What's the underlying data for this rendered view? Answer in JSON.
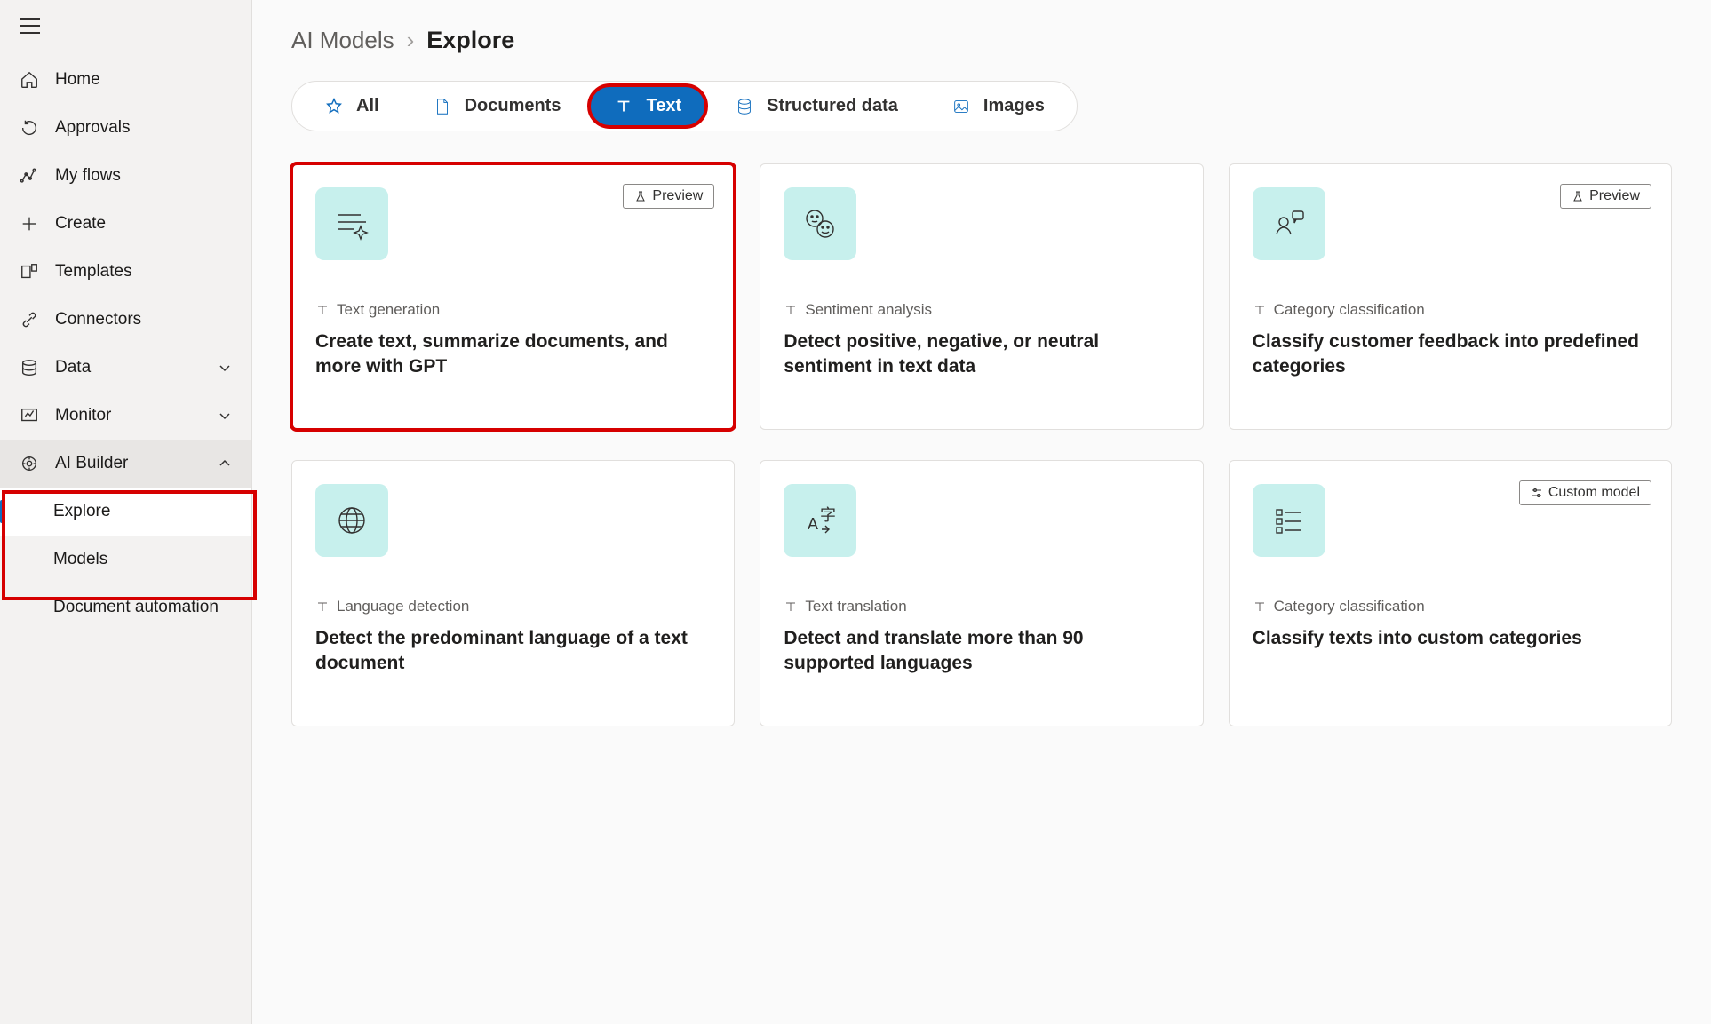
{
  "sidebar": {
    "items": [
      {
        "id": "home",
        "label": "Home"
      },
      {
        "id": "approvals",
        "label": "Approvals"
      },
      {
        "id": "myflows",
        "label": "My flows"
      },
      {
        "id": "create",
        "label": "Create"
      },
      {
        "id": "templates",
        "label": "Templates"
      },
      {
        "id": "connectors",
        "label": "Connectors"
      },
      {
        "id": "data",
        "label": "Data",
        "expandable": true
      },
      {
        "id": "monitor",
        "label": "Monitor",
        "expandable": true
      },
      {
        "id": "aibuilder",
        "label": "AI Builder",
        "expandable": true,
        "expanded": true
      }
    ],
    "aibuilder_children": [
      {
        "id": "explore",
        "label": "Explore",
        "active": true
      },
      {
        "id": "models",
        "label": "Models"
      },
      {
        "id": "docauto",
        "label": "Document automation"
      }
    ]
  },
  "breadcrumb": {
    "parent": "AI Models",
    "current": "Explore"
  },
  "filters": [
    {
      "id": "all",
      "label": "All"
    },
    {
      "id": "documents",
      "label": "Documents"
    },
    {
      "id": "text",
      "label": "Text",
      "active": true
    },
    {
      "id": "structured",
      "label": "Structured data"
    },
    {
      "id": "images",
      "label": "Images"
    }
  ],
  "cards_row1": [
    {
      "badge": "Preview",
      "category": "Text generation",
      "title": "Create text, summarize documents, and more with GPT",
      "icon": "sparkle-lines"
    },
    {
      "category": "Sentiment analysis",
      "title": "Detect positive, negative, or neutral sentiment in text data",
      "icon": "faces"
    },
    {
      "badge": "Preview",
      "category": "Category classification",
      "title": "Classify customer feedback into predefined categories",
      "icon": "person-feedback"
    }
  ],
  "cards_row2": [
    {
      "category": "Language detection",
      "title": "Detect the predominant language of a text document",
      "icon": "globe"
    },
    {
      "category": "Text translation",
      "title": "Detect and translate more than 90 supported languages",
      "icon": "translate"
    },
    {
      "badge": "Custom model",
      "badge_icon": "sliders",
      "category": "Category classification",
      "title": "Classify texts into custom categories",
      "icon": "list-squares"
    }
  ]
}
